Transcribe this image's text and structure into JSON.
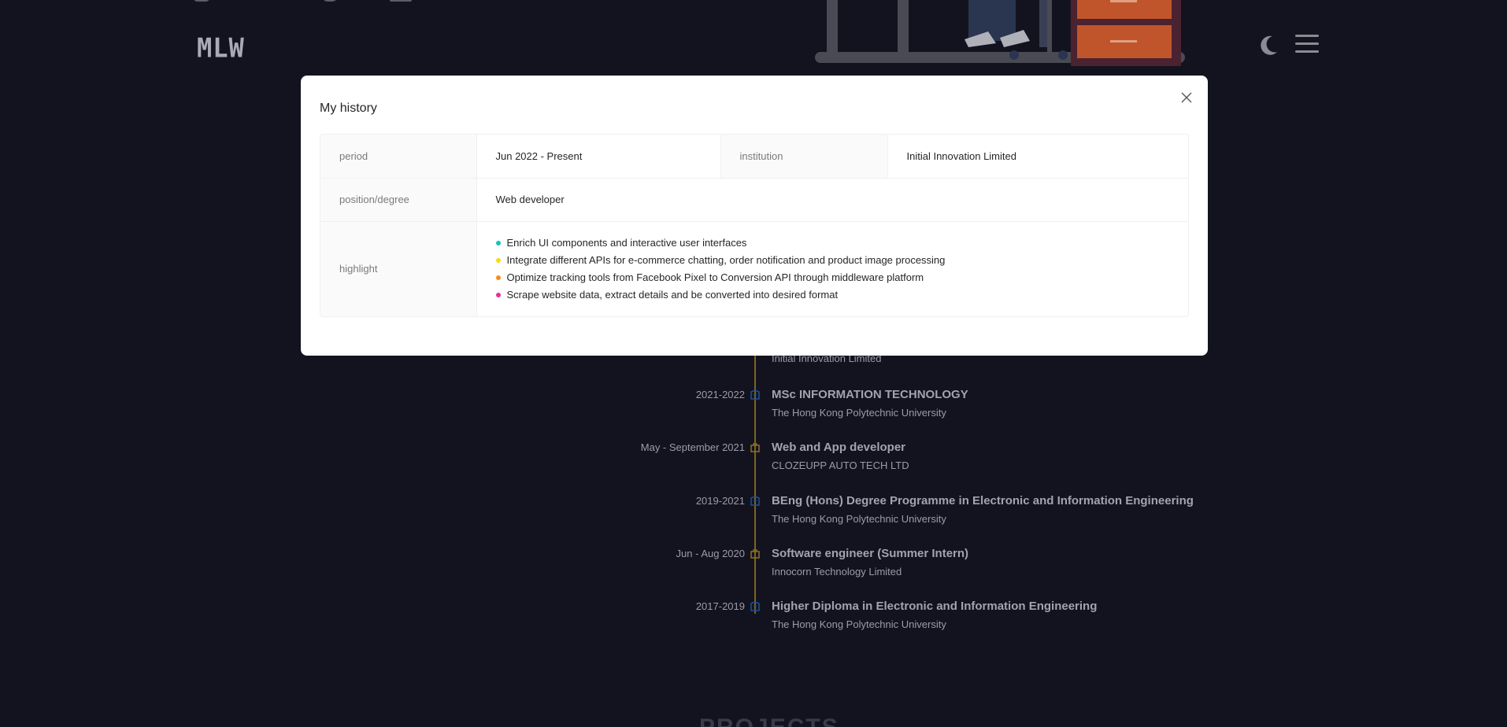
{
  "header": {
    "logo": "MLW"
  },
  "timeline": [
    {
      "date": "",
      "title": "",
      "subtitle": "Initial Innovation Limited",
      "kind": "work"
    },
    {
      "date": "2021-2022",
      "title": "MSc INFORMATION TECHNOLOGY",
      "subtitle": "The Hong Kong Polytechnic University",
      "kind": "education"
    },
    {
      "date": "May - September 2021",
      "title": "Web and App developer",
      "subtitle": "CLOZEUPP AUTO TECH LTD",
      "kind": "work"
    },
    {
      "date": "2019-2021",
      "title": "BEng (Hons) Degree Programme in Electronic and Information Engineering",
      "subtitle": "The Hong Kong Polytechnic University",
      "kind": "education"
    },
    {
      "date": "Jun - Aug 2020",
      "title": "Software engineer (Summer Intern)",
      "subtitle": "Innocorn Technology Limited",
      "kind": "work"
    },
    {
      "date": "2017-2019",
      "title": "Higher Diploma in Electronic and Information Engineering",
      "subtitle": "The Hong Kong Polytechnic University",
      "kind": "education"
    }
  ],
  "section_heading": "PROJECTS",
  "modal": {
    "title": "My history",
    "period_label": "period",
    "period_value": "Jun 2022 - Present",
    "institution_label": "institution",
    "institution_value": "Initial Innovation Limited",
    "position_label": "position/degree",
    "position_value": "Web developer",
    "highlight_label": "highlight",
    "highlights": [
      {
        "text": "Enrich UI components and interactive user interfaces",
        "color": "#13c2c2"
      },
      {
        "text": "Integrate different APIs for e-commerce chatting, order notification and product image processing",
        "color": "#fadb14"
      },
      {
        "text": "Optimize tracking tools from Facebook Pixel to Conversion API through middleware platform",
        "color": "#fa8c16"
      },
      {
        "text": "Scrape website data, extract details and be converted into desired format",
        "color": "#eb2f96"
      }
    ]
  },
  "colors": {
    "background": "#13131f",
    "timeline_line": "#7a6520",
    "education_icon": "#1d4f91",
    "work_icon": "#8a6d1c"
  }
}
